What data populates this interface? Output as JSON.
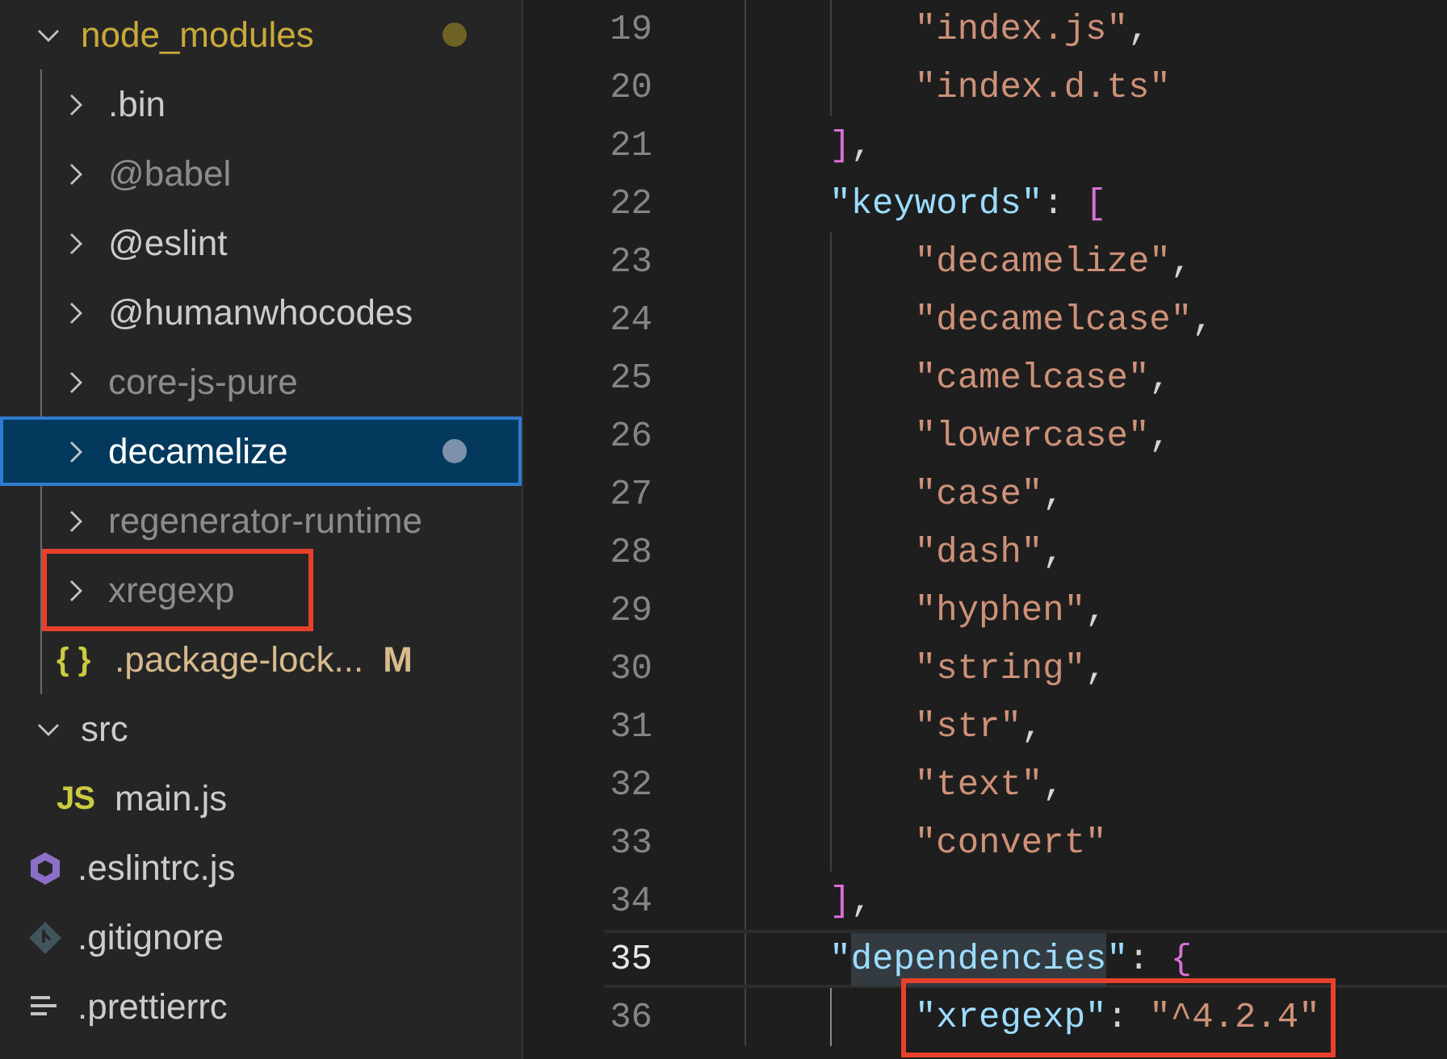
{
  "explorer": {
    "items": [
      {
        "label": "node_modules",
        "kind": "folder",
        "expanded": true,
        "selected": false,
        "ignored": false,
        "modified": true,
        "dot": true,
        "children": [
          {
            "label": ".bin",
            "kind": "folder",
            "expanded": false,
            "selected": false,
            "ignored": false,
            "modified": false,
            "dot": false
          },
          {
            "label": "@babel",
            "kind": "folder",
            "expanded": false,
            "selected": false,
            "ignored": true,
            "modified": false,
            "dot": false
          },
          {
            "label": "@eslint",
            "kind": "folder",
            "expanded": false,
            "selected": false,
            "ignored": false,
            "modified": false,
            "dot": false
          },
          {
            "label": "@humanwhocodes",
            "kind": "folder",
            "expanded": false,
            "selected": false,
            "ignored": false,
            "modified": false,
            "dot": false
          },
          {
            "label": "core-js-pure",
            "kind": "folder",
            "expanded": false,
            "selected": false,
            "ignored": true,
            "modified": false,
            "dot": false
          },
          {
            "label": "decamelize",
            "kind": "folder",
            "expanded": false,
            "selected": true,
            "ignored": false,
            "modified": false,
            "dot": true
          },
          {
            "label": "regenerator-runtime",
            "kind": "folder",
            "expanded": false,
            "selected": false,
            "ignored": true,
            "modified": false,
            "dot": false
          },
          {
            "label": "xregexp",
            "kind": "folder",
            "expanded": false,
            "selected": false,
            "ignored": true,
            "modified": false,
            "dot": false,
            "boxed": true
          },
          {
            "label": ".package-lock...",
            "kind": "json",
            "icon_text": "{ }",
            "badge": "M",
            "selected": false,
            "ignored": false,
            "modified": true
          }
        ]
      },
      {
        "label": "src",
        "kind": "folder",
        "expanded": true,
        "selected": false,
        "ignored": false,
        "modified": false,
        "dot": false,
        "children": [
          {
            "label": "main.js",
            "kind": "js",
            "icon_text": "JS",
            "selected": false,
            "ignored": false,
            "modified": false
          }
        ]
      },
      {
        "label": ".eslintrc.js",
        "kind": "eslint",
        "selected": false,
        "ignored": false,
        "modified": false
      },
      {
        "label": ".gitignore",
        "kind": "git",
        "selected": false,
        "ignored": false,
        "modified": false
      },
      {
        "label": ".prettierrc",
        "kind": "config",
        "selected": false,
        "ignored": false,
        "modified": false
      }
    ]
  },
  "editor": {
    "lines": [
      {
        "number": "19",
        "current": false,
        "tokens": [
          {
            "kind": "string",
            "text": "            \"index.js\""
          },
          {
            "kind": "punct",
            "text": ","
          }
        ]
      },
      {
        "number": "20",
        "current": false,
        "tokens": [
          {
            "kind": "string",
            "text": "            \"index.d.ts\""
          }
        ]
      },
      {
        "number": "21",
        "current": false,
        "tokens": [
          {
            "kind": "bracket",
            "text": "        ]"
          },
          {
            "kind": "punct",
            "text": ","
          }
        ]
      },
      {
        "number": "22",
        "current": false,
        "tokens": [
          {
            "kind": "key",
            "text": "        \"keywords\""
          },
          {
            "kind": "punct",
            "text": ": "
          },
          {
            "kind": "bracket",
            "text": "["
          }
        ]
      },
      {
        "number": "23",
        "current": false,
        "tokens": [
          {
            "kind": "string",
            "text": "            \"decamelize\""
          },
          {
            "kind": "punct",
            "text": ","
          }
        ]
      },
      {
        "number": "24",
        "current": false,
        "tokens": [
          {
            "kind": "string",
            "text": "            \"decamelcase\""
          },
          {
            "kind": "punct",
            "text": ","
          }
        ]
      },
      {
        "number": "25",
        "current": false,
        "tokens": [
          {
            "kind": "string",
            "text": "            \"camelcase\""
          },
          {
            "kind": "punct",
            "text": ","
          }
        ]
      },
      {
        "number": "26",
        "current": false,
        "tokens": [
          {
            "kind": "string",
            "text": "            \"lowercase\""
          },
          {
            "kind": "punct",
            "text": ","
          }
        ]
      },
      {
        "number": "27",
        "current": false,
        "tokens": [
          {
            "kind": "string",
            "text": "            \"case\""
          },
          {
            "kind": "punct",
            "text": ","
          }
        ]
      },
      {
        "number": "28",
        "current": false,
        "tokens": [
          {
            "kind": "string",
            "text": "            \"dash\""
          },
          {
            "kind": "punct",
            "text": ","
          }
        ]
      },
      {
        "number": "29",
        "current": false,
        "tokens": [
          {
            "kind": "string",
            "text": "            \"hyphen\""
          },
          {
            "kind": "punct",
            "text": ","
          }
        ]
      },
      {
        "number": "30",
        "current": false,
        "tokens": [
          {
            "kind": "string",
            "text": "            \"string\""
          },
          {
            "kind": "punct",
            "text": ","
          }
        ]
      },
      {
        "number": "31",
        "current": false,
        "tokens": [
          {
            "kind": "string",
            "text": "            \"str\""
          },
          {
            "kind": "punct",
            "text": ","
          }
        ]
      },
      {
        "number": "32",
        "current": false,
        "tokens": [
          {
            "kind": "string",
            "text": "            \"text\""
          },
          {
            "kind": "punct",
            "text": ","
          }
        ]
      },
      {
        "number": "33",
        "current": false,
        "tokens": [
          {
            "kind": "string",
            "text": "            \"convert\""
          }
        ]
      },
      {
        "number": "34",
        "current": false,
        "tokens": [
          {
            "kind": "bracket",
            "text": "        ]"
          },
          {
            "kind": "punct",
            "text": ","
          }
        ]
      },
      {
        "number": "35",
        "current": true,
        "tokens": [
          {
            "kind": "key",
            "text": "        \""
          },
          {
            "kind": "key",
            "text": "dependencies",
            "highlighted": true
          },
          {
            "kind": "key",
            "text": "\""
          },
          {
            "kind": "punct",
            "text": ": "
          },
          {
            "kind": "bracket",
            "text": "{"
          }
        ]
      },
      {
        "number": "36",
        "current": false,
        "boxed": true,
        "tokens": [
          {
            "kind": "key",
            "text": "            \"xregexp\""
          },
          {
            "kind": "punct",
            "text": ": "
          },
          {
            "kind": "string",
            "text": "\"^4.2.4\""
          }
        ]
      }
    ]
  }
}
